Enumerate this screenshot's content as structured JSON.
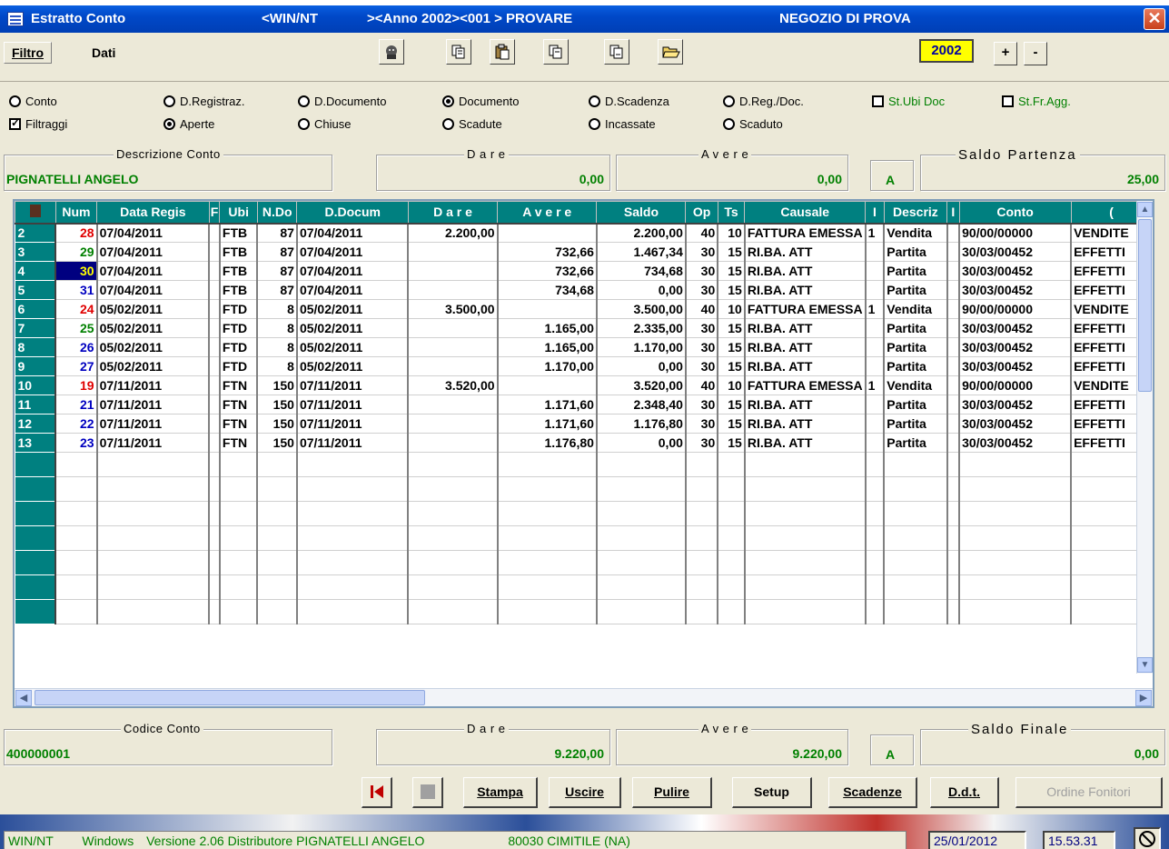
{
  "title_bar": {
    "title": "Estratto Conto",
    "platform": "<WIN/NT",
    "context": "><Anno 2002><001 > PROVARE",
    "shop": "NEGOZIO DI PROVA",
    "close": "✕"
  },
  "toolbar": {
    "menu_filtro": "Filtro",
    "menu_dati": "Dati",
    "year": "2002",
    "plus": "+",
    "minus": "-"
  },
  "options": {
    "conto": "Conto",
    "d_registraz": "D.Registraz.",
    "d_documento": "D.Documento",
    "documento": "Documento",
    "d_scadenza": "D.Scadenza",
    "d_reg_doc": "D.Reg./Doc.",
    "st_ubi_doc": "St.Ubi Doc",
    "st_fr_agg": "St.Fr.Agg.",
    "filtraggi": "Filtraggi",
    "aperte": "Aperte",
    "chiuse": "Chiuse",
    "scadute": "Scadute",
    "incassate": "Incassate",
    "scaduto": "Scaduto",
    "selected_ordering": "Documento",
    "selected_status": "Aperte"
  },
  "summary_top": {
    "descrizione_label": "Descrizione Conto",
    "descrizione_value": "PIGNATELLI ANGELO",
    "dare_label": "D a r e",
    "dare_value": "0,00",
    "avere_label": "A v e r e",
    "avere_value": "0,00",
    "sign": "A",
    "saldo_label": "Saldo  Partenza",
    "saldo_value": "25,00"
  },
  "grid": {
    "columns": [
      "Num",
      "Data Regis",
      "F",
      "Ubi",
      "N.Do",
      "D.Docum",
      "D a r e",
      "A v e r e",
      "Saldo",
      "Op",
      "Ts",
      "Causale",
      "I",
      "Descriz",
      "I",
      "Conto",
      "("
    ],
    "rows": [
      {
        "rn": "2",
        "num": "28",
        "num_color": "red",
        "data": "07/04/2011",
        "ubi": "FTB",
        "ndoc": "87",
        "ddoc": "07/04/2011",
        "dare": "2.200,00",
        "avere": "",
        "saldo": "2.200,00",
        "op": "40",
        "ts": "10",
        "causale": "FATTURA EMESSA",
        "i": "1",
        "descr": "Vendita",
        "conto": "90/00/00000",
        "desc2": "VENDITE"
      },
      {
        "rn": "3",
        "num": "29",
        "num_color": "green",
        "data": "07/04/2011",
        "ubi": "FTB",
        "ndoc": "87",
        "ddoc": "07/04/2011",
        "dare": "",
        "avere": "732,66",
        "saldo": "1.467,34",
        "op": "30",
        "ts": "15",
        "causale": "RI.BA. ATT",
        "i": "",
        "descr": "Partita",
        "conto": "30/03/00452",
        "desc2": "EFFETTI"
      },
      {
        "rn": "4",
        "num": "30",
        "num_color": "sel",
        "data": "07/04/2011",
        "ubi": "FTB",
        "ndoc": "87",
        "ddoc": "07/04/2011",
        "dare": "",
        "avere": "732,66",
        "saldo": "734,68",
        "op": "30",
        "ts": "15",
        "causale": "RI.BA. ATT",
        "i": "",
        "descr": "Partita",
        "conto": "30/03/00452",
        "desc2": "EFFETTI"
      },
      {
        "rn": "5",
        "num": "31",
        "num_color": "blue",
        "data": "07/04/2011",
        "ubi": "FTB",
        "ndoc": "87",
        "ddoc": "07/04/2011",
        "dare": "",
        "avere": "734,68",
        "saldo": "0,00",
        "op": "30",
        "ts": "15",
        "causale": "RI.BA. ATT",
        "i": "",
        "descr": "Partita",
        "conto": "30/03/00452",
        "desc2": "EFFETTI"
      },
      {
        "rn": "6",
        "num": "24",
        "num_color": "red",
        "data": "05/02/2011",
        "ubi": "FTD",
        "ndoc": "8",
        "ddoc": "05/02/2011",
        "dare": "3.500,00",
        "avere": "",
        "saldo": "3.500,00",
        "op": "40",
        "ts": "10",
        "causale": "FATTURA EMESSA",
        "i": "1",
        "descr": "Vendita",
        "conto": "90/00/00000",
        "desc2": "VENDITE"
      },
      {
        "rn": "7",
        "num": "25",
        "num_color": "green",
        "data": "05/02/2011",
        "ubi": "FTD",
        "ndoc": "8",
        "ddoc": "05/02/2011",
        "dare": "",
        "avere": "1.165,00",
        "saldo": "2.335,00",
        "op": "30",
        "ts": "15",
        "causale": "RI.BA. ATT",
        "i": "",
        "descr": "Partita",
        "conto": "30/03/00452",
        "desc2": "EFFETTI"
      },
      {
        "rn": "8",
        "num": "26",
        "num_color": "blue",
        "data": "05/02/2011",
        "ubi": "FTD",
        "ndoc": "8",
        "ddoc": "05/02/2011",
        "dare": "",
        "avere": "1.165,00",
        "saldo": "1.170,00",
        "op": "30",
        "ts": "15",
        "causale": "RI.BA. ATT",
        "i": "",
        "descr": "Partita",
        "conto": "30/03/00452",
        "desc2": "EFFETTI"
      },
      {
        "rn": "9",
        "num": "27",
        "num_color": "blue",
        "data": "05/02/2011",
        "ubi": "FTD",
        "ndoc": "8",
        "ddoc": "05/02/2011",
        "dare": "",
        "avere": "1.170,00",
        "saldo": "0,00",
        "op": "30",
        "ts": "15",
        "causale": "RI.BA. ATT",
        "i": "",
        "descr": "Partita",
        "conto": "30/03/00452",
        "desc2": "EFFETTI"
      },
      {
        "rn": "10",
        "num": "19",
        "num_color": "red",
        "data": "07/11/2011",
        "ubi": "FTN",
        "ndoc": "150",
        "ddoc": "07/11/2011",
        "dare": "3.520,00",
        "avere": "",
        "saldo": "3.520,00",
        "op": "40",
        "ts": "10",
        "causale": "FATTURA EMESSA",
        "i": "1",
        "descr": "Vendita",
        "conto": "90/00/00000",
        "desc2": "VENDITE"
      },
      {
        "rn": "11",
        "num": "21",
        "num_color": "blue",
        "data": "07/11/2011",
        "ubi": "FTN",
        "ndoc": "150",
        "ddoc": "07/11/2011",
        "dare": "",
        "avere": "1.171,60",
        "saldo": "2.348,40",
        "op": "30",
        "ts": "15",
        "causale": "RI.BA. ATT",
        "i": "",
        "descr": "Partita",
        "conto": "30/03/00452",
        "desc2": "EFFETTI"
      },
      {
        "rn": "12",
        "num": "22",
        "num_color": "blue",
        "data": "07/11/2011",
        "ubi": "FTN",
        "ndoc": "150",
        "ddoc": "07/11/2011",
        "dare": "",
        "avere": "1.171,60",
        "saldo": "1.176,80",
        "op": "30",
        "ts": "15",
        "causale": "RI.BA. ATT",
        "i": "",
        "descr": "Partita",
        "conto": "30/03/00452",
        "desc2": "EFFETTI"
      },
      {
        "rn": "13",
        "num": "23",
        "num_color": "blue",
        "data": "07/11/2011",
        "ubi": "FTN",
        "ndoc": "150",
        "ddoc": "07/11/2011",
        "dare": "",
        "avere": "1.176,80",
        "saldo": "0,00",
        "op": "30",
        "ts": "15",
        "causale": "RI.BA. ATT",
        "i": "",
        "descr": "Partita",
        "conto": "30/03/00452",
        "desc2": "EFFETTI"
      }
    ],
    "empty_rows": 7
  },
  "summary_bottom": {
    "codice_label": "Codice Conto",
    "codice_value": "400000001",
    "dare_label": "D a r e",
    "dare_value": "9.220,00",
    "avere_label": "A v e r e",
    "avere_value": "9.220,00",
    "sign": "A",
    "saldo_label": "Saldo  Finale",
    "saldo_value": "0,00"
  },
  "buttons": {
    "stampa": "Stampa",
    "uscire": "Uscire",
    "pulire": "Pulire",
    "setup": "Setup",
    "scadenze": "Scadenze",
    "ddt": "D.d.t.",
    "ordine_fornitori": "Ordine Fonitori"
  },
  "status_bar": {
    "os": "WIN/NT",
    "env": "Windows",
    "version": "Versione 2.06 Distributore PIGNATELLI ANGELO",
    "location": "80030 CIMITILE (NA)",
    "date": "25/01/2012",
    "time": "15.53.31"
  },
  "colors": {
    "title_bar": "#0048c8",
    "grid_header": "#008080",
    "value_green": "#008000",
    "selection": "#000080",
    "year_box": "#ffff00"
  }
}
